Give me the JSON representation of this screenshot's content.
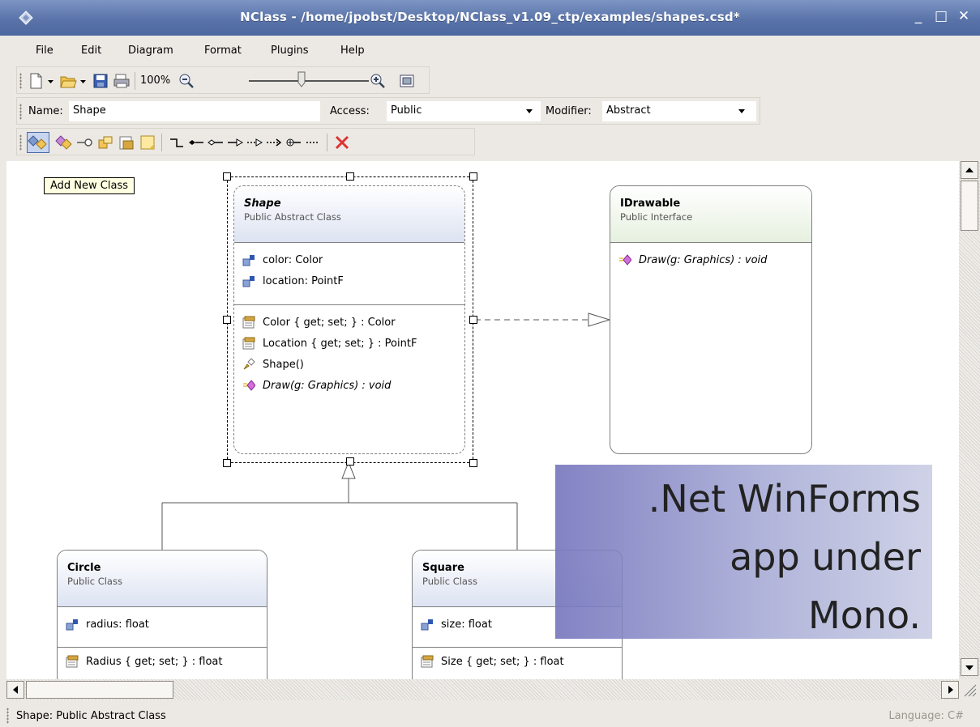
{
  "window": {
    "title": "NClass - /home/jpobst/Desktop/NClass_v1.09_ctp/examples/shapes.csd*",
    "minimize_glyph": "_",
    "maximize_glyph": "□",
    "close_glyph": "✕"
  },
  "menu": [
    "File",
    "Edit",
    "Diagram",
    "Format",
    "Plugins",
    "Help"
  ],
  "toolbar": {
    "zoom_level": "100%",
    "icons": [
      "new-document-icon",
      "open-folder-icon",
      "save-icon",
      "print-icon",
      "zoom-out-icon",
      "zoom-in-icon",
      "fit-to-window-icon"
    ]
  },
  "properties": {
    "name_label": "Name:",
    "name_value": "Shape",
    "access_label": "Access:",
    "access_value": "Public",
    "modifier_label": "Modifier:",
    "modifier_value": "Abstract"
  },
  "tooltip": "Add New Class",
  "diagram": {
    "classes": {
      "shape": {
        "name": "Shape",
        "kind": "Public Abstract Class",
        "fields": [
          "color: Color",
          "location: PointF"
        ],
        "methods": [
          "Color { get; set; } : Color",
          "Location { get; set; } : PointF",
          "Shape()",
          "Draw(g: Graphics) : void"
        ]
      },
      "idrawable": {
        "name": "IDrawable",
        "kind": "Public Interface",
        "methods": [
          "Draw(g: Graphics) : void"
        ]
      },
      "circle": {
        "name": "Circle",
        "kind": "Public Class",
        "fields": [
          "radius: float"
        ],
        "methods": [
          "Radius { get; set; } : float"
        ]
      },
      "square": {
        "name": "Square",
        "kind": "Public Class",
        "fields": [
          "size: float"
        ],
        "methods": [
          "Size { get; set; } : float"
        ]
      }
    }
  },
  "overlay": {
    "lines": [
      ".Net WinForms",
      "app under",
      "Mono."
    ]
  },
  "status": {
    "left": "Shape: Public Abstract Class",
    "right": "Language: C#"
  },
  "colors": {
    "titlebar": "#5a74aa",
    "class_header": "#dde3f2",
    "interface_header": "#e6f0df",
    "selection_frame": "#000000"
  }
}
